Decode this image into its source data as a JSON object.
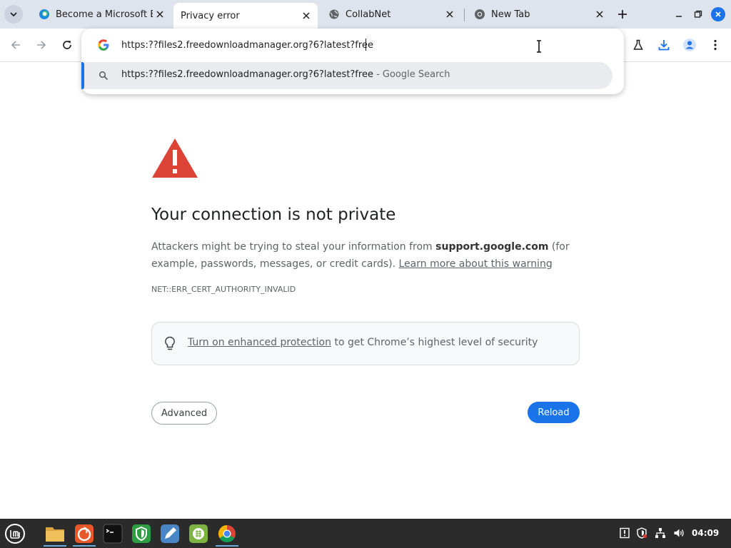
{
  "colors": {
    "tabstrip_bg": "#dfe3eb",
    "accent_blue": "#1a73e8",
    "warning_red": "#db4437",
    "taskbar_bg": "#2b2b2b"
  },
  "tabs": [
    {
      "title": "Become a Microsoft Ec",
      "icon": "edge-icon",
      "active": false
    },
    {
      "title": "Privacy error",
      "icon": "none",
      "active": true
    },
    {
      "title": "CollabNet",
      "icon": "globe-icon",
      "active": false
    },
    {
      "title": "New Tab",
      "icon": "chrome-icon",
      "active": false
    }
  ],
  "omnibox": {
    "value": "https:??files2.freedownloadmanager.org?6?latest?free",
    "suggestion": {
      "text": "https:??files2.freedownloadmanager.org?6?latest?free",
      "suffix": " - Google Search"
    }
  },
  "error_page": {
    "heading": "Your connection is not private",
    "desc_part1": "Attackers might be trying to steal your information from ",
    "desc_domain": "support.google.com",
    "desc_part2": " (for example, passwords, messages, or credit cards). ",
    "desc_link": "Learn more about this warning",
    "error_code": "NET::ERR_CERT_AUTHORITY_INVALID",
    "enhanced_link": "Turn on enhanced protection",
    "enhanced_rest": " to get Chrome’s highest level of security",
    "advanced_label": "Advanced",
    "reload_label": "Reload"
  },
  "taskbar": {
    "apps": [
      "mint-menu-icon",
      "files-icon",
      "firefox-icon",
      "terminal-icon",
      "shield-app-icon",
      "editor-icon",
      "spreadsheet-icon",
      "chrome-icon"
    ],
    "clock": "04:09"
  }
}
